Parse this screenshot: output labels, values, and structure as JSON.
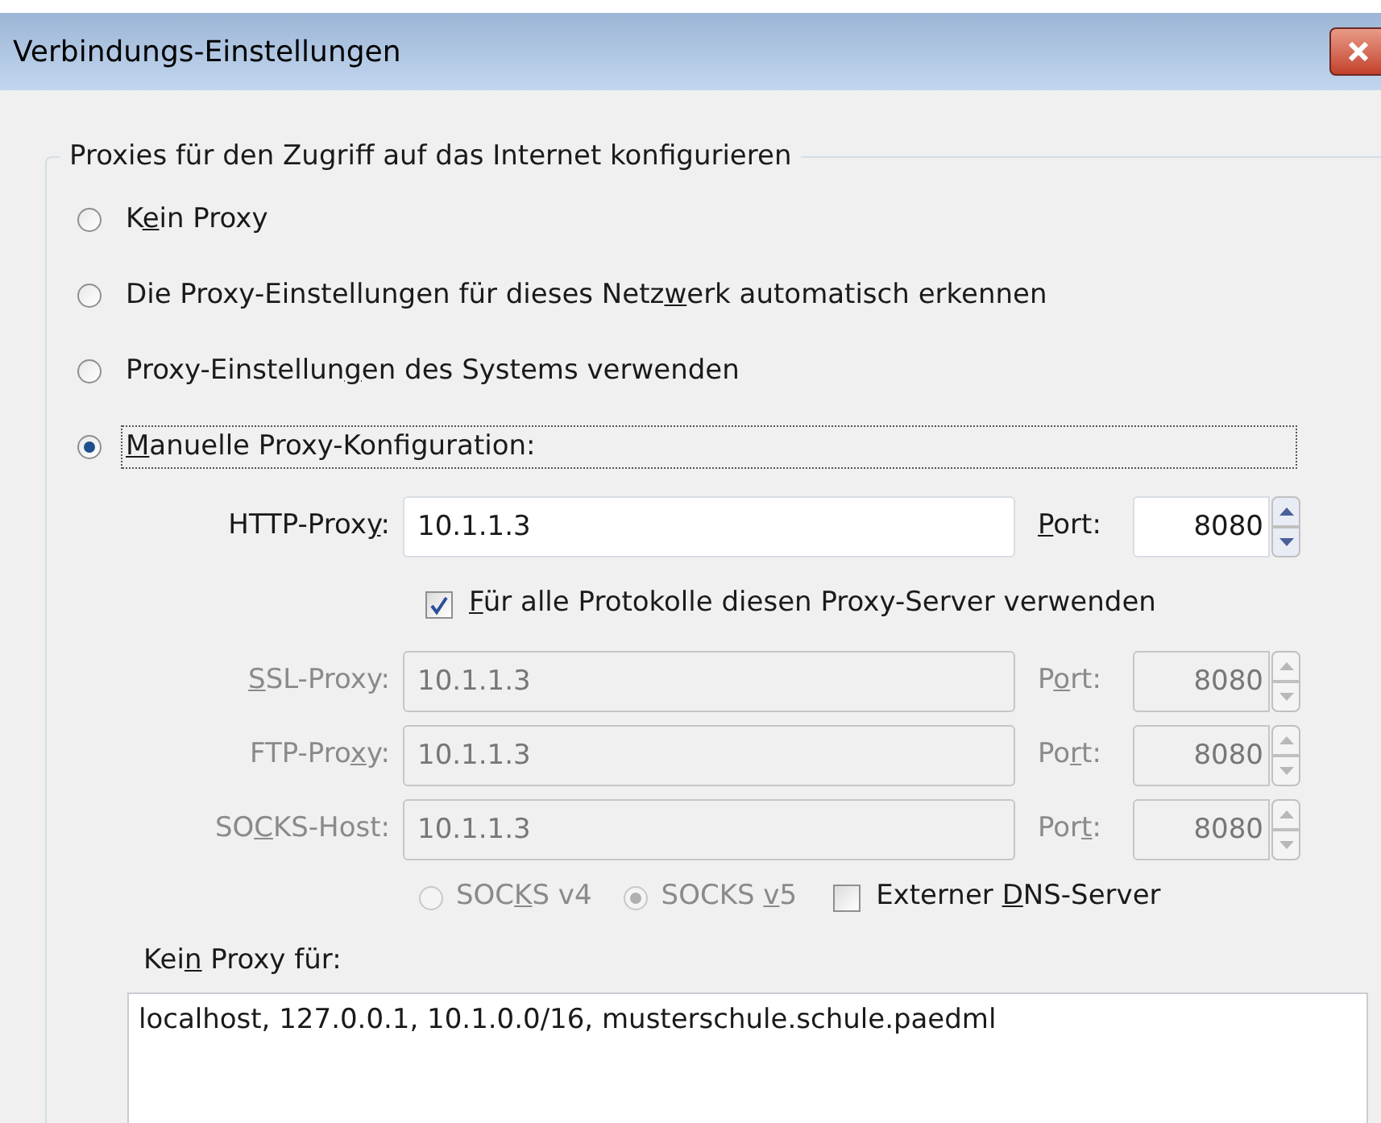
{
  "window": {
    "title": "Verbindungs-Einstellungen"
  },
  "group": {
    "title": "Proxies für den Zugriff auf das Internet konfigurieren"
  },
  "modes": [
    {
      "label_start": "K",
      "accesskey": "e",
      "label_end": "in Proxy",
      "selected": false,
      "focused": false
    },
    {
      "label_start": "Die Proxy-Einstellungen für dieses Netz",
      "accesskey": "w",
      "label_end": "erk automatisch erkennen",
      "selected": false,
      "focused": false
    },
    {
      "label_start": "Proxy-Einstellun",
      "accesskey": "g",
      "label_end": "en des Systems verwenden",
      "selected": false,
      "focused": false
    },
    {
      "accesskey": "M",
      "label_end": "anuelle Proxy-Konfiguration:",
      "selected": true,
      "focused": true
    }
  ],
  "proxies": [
    {
      "label_start": "HTTP-Prox",
      "accesskey": "y",
      "label_end": ":",
      "value": "10.1.1.3",
      "disabled": false,
      "port_accesskey": "P",
      "port_label_end": "ort:",
      "port": "8080"
    },
    {
      "accesskey": "S",
      "label_end": "SL-Proxy:",
      "value": "10.1.1.3",
      "disabled": true,
      "port_label_start": "P",
      "port_accesskey": "o",
      "port_label_end": "rt:",
      "port": "8080"
    },
    {
      "label_start": "FTP-Pro",
      "accesskey": "x",
      "label_end": "y:",
      "value": "10.1.1.3",
      "disabled": true,
      "port_label_start": "Po",
      "port_accesskey": "r",
      "port_label_end": "t:",
      "port": "8080"
    },
    {
      "label_start": "SO",
      "accesskey": "C",
      "label_end": "KS-Host:",
      "value": "10.1.1.3",
      "disabled": true,
      "port_label_start": "Por",
      "port_accesskey": "t",
      "port_label_end": ":",
      "port": "8080"
    }
  ],
  "share_all": {
    "accesskey": "F",
    "label_end": "ür alle Protokolle diesen Proxy-Server verwenden",
    "checked": true
  },
  "socks_versions": [
    {
      "label_start": "SOC",
      "accesskey": "K",
      "label_end": "S v4",
      "selected": false,
      "disabled": true
    },
    {
      "label_start": "SOCKS ",
      "accesskey": "v",
      "label_end": "5",
      "selected": true,
      "disabled": true
    }
  ],
  "remote_dns": {
    "label_start": "Externer ",
    "accesskey": "D",
    "label_end": "NS-Server",
    "checked": false
  },
  "no_proxy": {
    "label_start": "Kei",
    "accesskey": "n",
    "label_end": " Proxy für:",
    "value": "localhost, 127.0.0.1, 10.1.0.0/16, musterschule.schule.paedml"
  }
}
